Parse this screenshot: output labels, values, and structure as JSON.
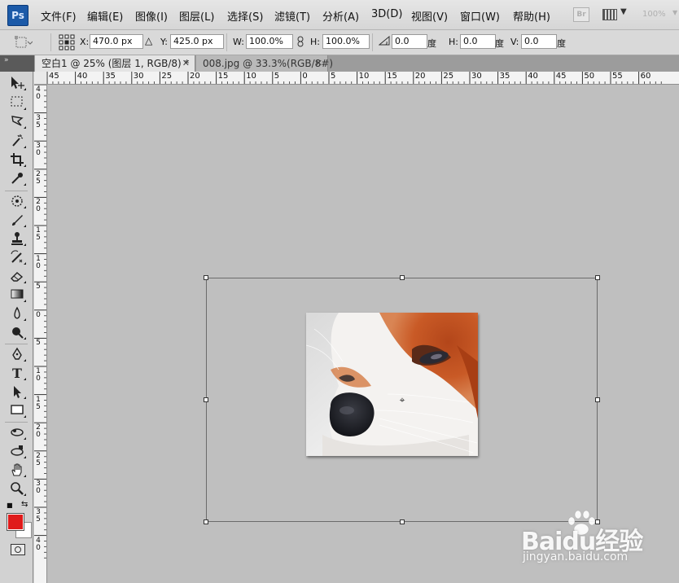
{
  "app": {
    "logo_text": "Ps"
  },
  "menu": {
    "items": [
      "文件(F)",
      "编辑(E)",
      "图像(I)",
      "图层(L)",
      "选择(S)",
      "滤镜(T)",
      "分析(A)",
      "3D(D)",
      "视图(V)",
      "窗口(W)",
      "帮助(H)"
    ],
    "bridge_label": "Br",
    "zoom": "100%"
  },
  "options": {
    "x_label": "X:",
    "x_value": "470.0 px",
    "y_label": "Y:",
    "y_value": "425.0 px",
    "w_label": "W:",
    "w_value": "100.0%",
    "h_label": "H:",
    "h_value": "100.0%",
    "angle_value": "0.0",
    "angle_unit": "度",
    "hskew_label": "H:",
    "hskew_value": "0.0",
    "hskew_unit": "度",
    "vskew_label": "V:",
    "vskew_value": "0.0",
    "vskew_unit": "度"
  },
  "tabs": [
    {
      "label": "空白1 @ 25% (图层 1, RGB/8) *",
      "active": true
    },
    {
      "label": "008.jpg @ 33.3%(RGB/8#)",
      "active": false
    }
  ],
  "ruler_top": [
    "45",
    "40",
    "35",
    "30",
    "25",
    "20",
    "15",
    "10",
    "5",
    "0",
    "5",
    "10",
    "15",
    "20",
    "25",
    "30",
    "35",
    "40",
    "45",
    "50",
    "55",
    "60"
  ],
  "ruler_left": [
    "40",
    "35",
    "30",
    "25",
    "20",
    "15",
    "10",
    "5",
    "0",
    "5",
    "10",
    "15",
    "20",
    "25",
    "30",
    "35",
    "40"
  ],
  "tools": [
    "move-tool",
    "marquee-tool",
    "lasso-tool",
    "magic-wand-tool",
    "crop-tool",
    "eyedropper-tool",
    "spot-healing-tool",
    "brush-tool",
    "clone-stamp-tool",
    "history-brush-tool",
    "eraser-tool",
    "gradient-tool",
    "blur-tool",
    "dodge-tool",
    "pen-tool",
    "type-tool",
    "path-selection-tool",
    "shape-tool",
    "3d-rotate-tool",
    "3d-orbit-tool",
    "hand-tool",
    "zoom-tool"
  ],
  "colors": {
    "foreground": "#e01b1b",
    "background": "#ffffff",
    "canvas": "#bfbfbf"
  },
  "watermark": {
    "brand": "Baidu经验",
    "url": "jingyan.baidu.com"
  }
}
